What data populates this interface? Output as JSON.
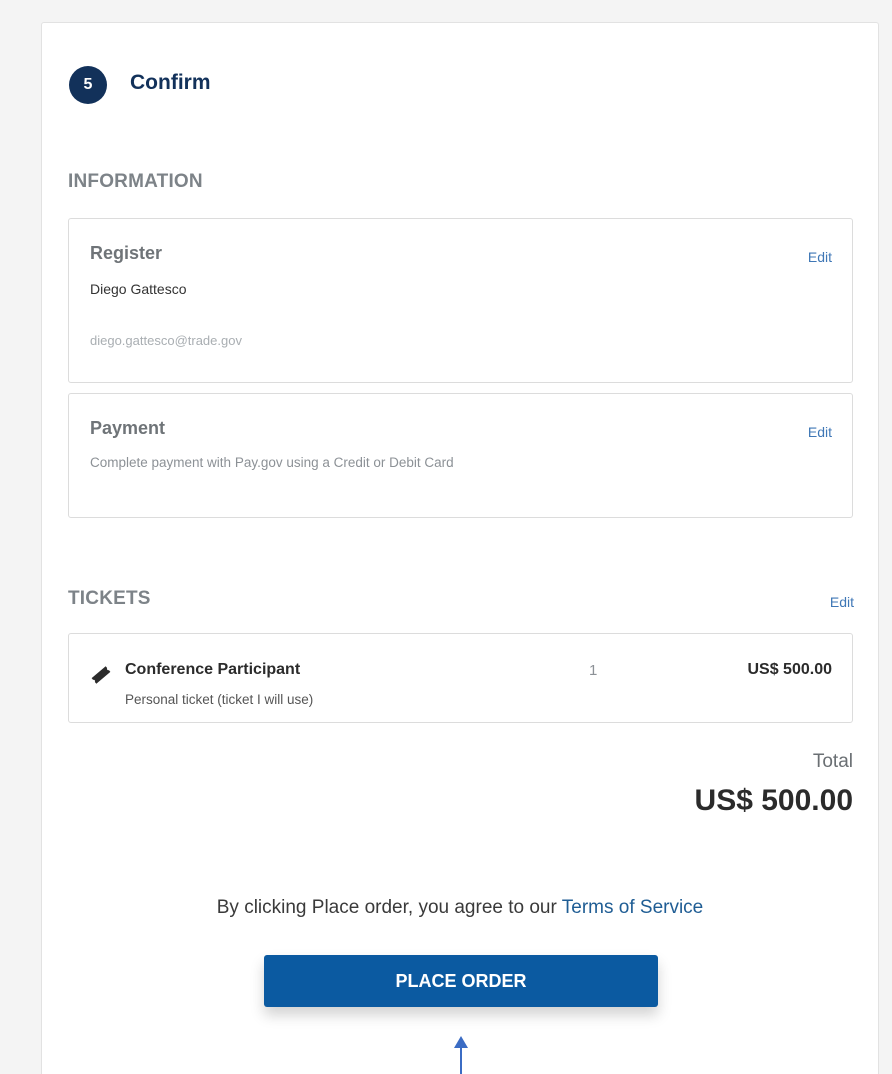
{
  "step": {
    "number": "5",
    "title": "Confirm"
  },
  "information": {
    "heading": "INFORMATION",
    "register": {
      "title": "Register",
      "edit_label": "Edit",
      "name": "Diego Gattesco",
      "email": "diego.gattesco@trade.gov"
    },
    "payment": {
      "title": "Payment",
      "edit_label": "Edit",
      "description": "Complete payment with Pay.gov using a Credit or Debit Card"
    }
  },
  "tickets": {
    "heading": "TICKETS",
    "edit_label": "Edit",
    "items": [
      {
        "icon": "ticket-icon",
        "name": "Conference Participant",
        "description": "Personal ticket (ticket I will use)",
        "quantity": "1",
        "price": "US$ 500.00"
      }
    ]
  },
  "total": {
    "label": "Total",
    "value": "US$ 500.00"
  },
  "agreement": {
    "prefix": "By clicking Place order, you agree to our ",
    "link_label": "Terms of Service"
  },
  "place_order_label": "PLACE ORDER",
  "colors": {
    "step_badge": "#12315a",
    "link": "#3f77b6",
    "primary_button": "#0b5aa1",
    "annotation_arrow": "#3b6cc4"
  }
}
